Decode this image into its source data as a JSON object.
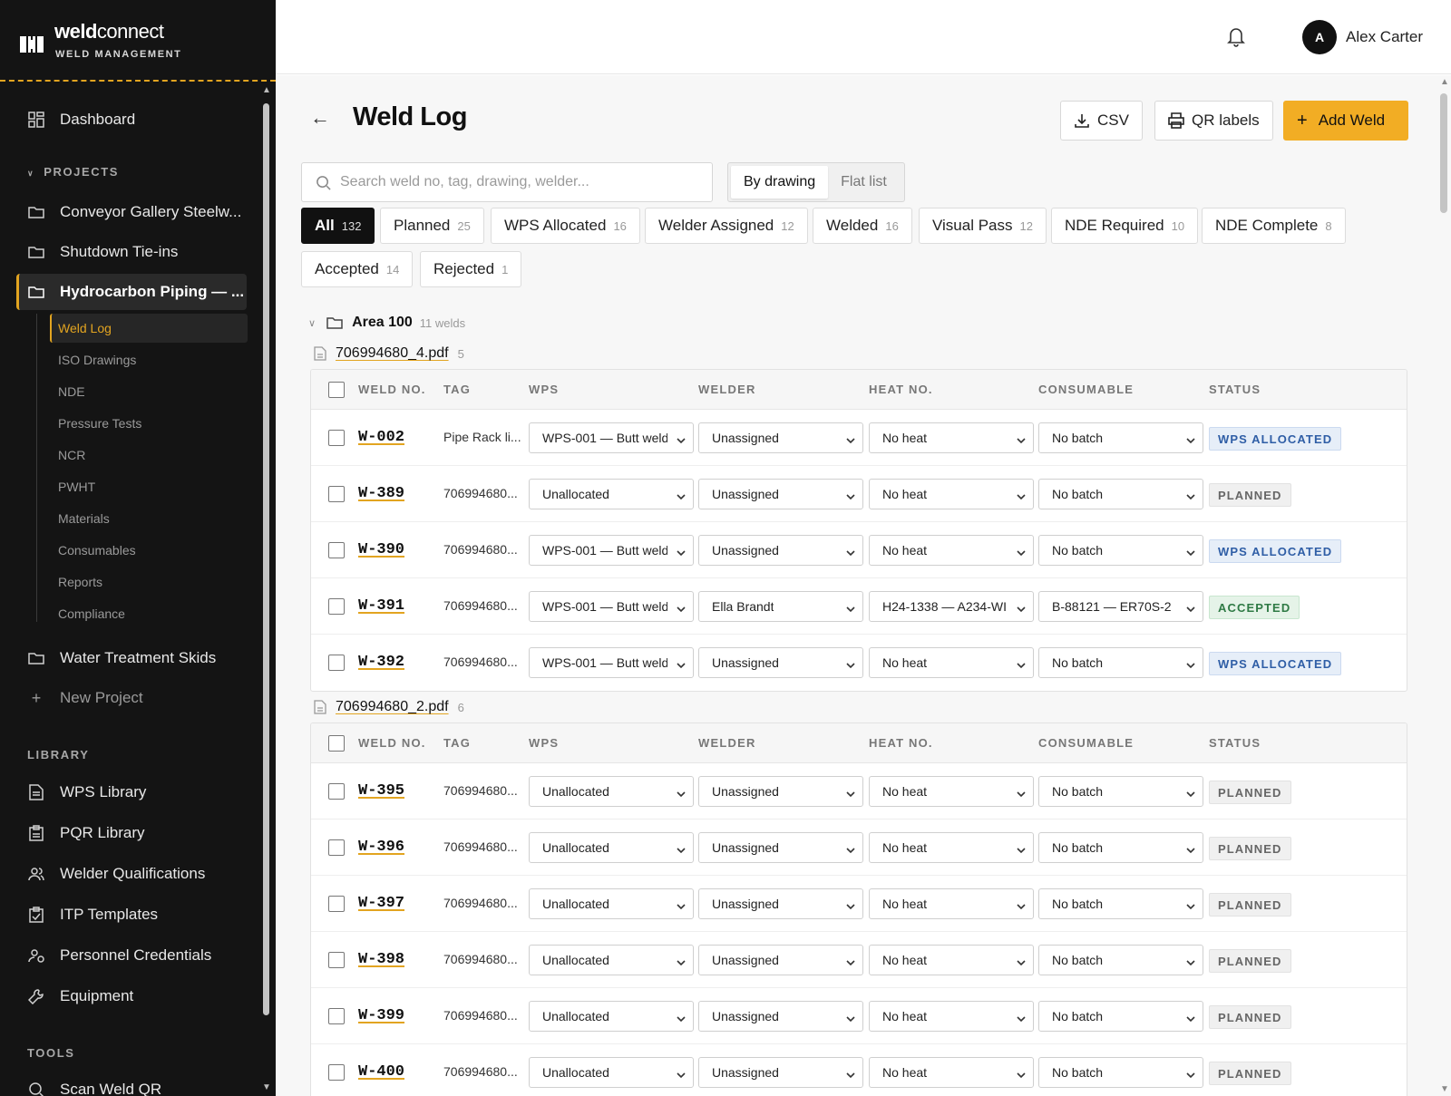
{
  "brand": {
    "name_bold": "weld",
    "name_rest": "connect",
    "subtitle": "WELD MANAGEMENT"
  },
  "sidebar": {
    "dashboard": "Dashboard",
    "projects_label": "PROJECTS",
    "projects": [
      {
        "label": "Conveyor Gallery Steelw...",
        "active": false
      },
      {
        "label": "Shutdown Tie-ins",
        "active": false
      },
      {
        "label": "Hydrocarbon Piping — ...",
        "active": true
      },
      {
        "label": "Water Treatment Skids",
        "active": false
      }
    ],
    "subnav": [
      "Weld Log",
      "ISO Drawings",
      "NDE",
      "Pressure Tests",
      "NCR",
      "PWHT",
      "Materials",
      "Consumables",
      "Reports",
      "Compliance"
    ],
    "new_project": "New Project",
    "library_label": "LIBRARY",
    "library": [
      {
        "label": "WPS Library",
        "icon": "document-icon"
      },
      {
        "label": "PQR Library",
        "icon": "clipboard-icon"
      },
      {
        "label": "Welder Qualifications",
        "icon": "users-icon"
      },
      {
        "label": "ITP Templates",
        "icon": "checklist-icon"
      },
      {
        "label": "Personnel Credentials",
        "icon": "user-badge-icon"
      },
      {
        "label": "Equipment",
        "icon": "wrench-icon"
      }
    ],
    "tools_label": "TOOLS",
    "tools": [
      {
        "label": "Scan Weld QR",
        "icon": "search-icon"
      }
    ]
  },
  "topbar": {
    "avatar_initial": "A",
    "user_name": "Alex Carter"
  },
  "page": {
    "title": "Weld Log",
    "buttons": {
      "csv": "CSV",
      "qr": "QR labels",
      "add": "Add Weld"
    },
    "search_placeholder": "Search weld no, tag, drawing, welder...",
    "view_toggle": {
      "by_drawing": "By drawing",
      "flat_list": "Flat list",
      "selected": "By drawing"
    },
    "filters": [
      {
        "label": "All",
        "count": "132",
        "active": true
      },
      {
        "label": "Planned",
        "count": "25"
      },
      {
        "label": "WPS Allocated",
        "count": "16"
      },
      {
        "label": "Welder Assigned",
        "count": "12"
      },
      {
        "label": "Welded",
        "count": "16"
      },
      {
        "label": "Visual Pass",
        "count": "12"
      },
      {
        "label": "NDE Required",
        "count": "10"
      },
      {
        "label": "NDE Complete",
        "count": "8"
      },
      {
        "label": "Accepted",
        "count": "14"
      },
      {
        "label": "Rejected",
        "count": "1"
      }
    ]
  },
  "columns": [
    "WELD NO.",
    "TAG",
    "WPS",
    "WELDER",
    "HEAT NO.",
    "CONSUMABLE",
    "STATUS"
  ],
  "group": {
    "name": "Area 100",
    "count": "11 welds"
  },
  "drawings": [
    {
      "file": "706994680_4.pdf",
      "count": "5",
      "rows": [
        {
          "weld": "W-002",
          "tag": "Pipe Rack li...",
          "wps": "WPS-001 — Butt weld",
          "welder": "Unassigned",
          "heat": "No heat",
          "consumable": "No batch",
          "status": "WPS ALLOCATED",
          "kind": "wps"
        },
        {
          "weld": "W-389",
          "tag": "706994680...",
          "wps": "Unallocated",
          "welder": "Unassigned",
          "heat": "No heat",
          "consumable": "No batch",
          "status": "PLANNED",
          "kind": "planned"
        },
        {
          "weld": "W-390",
          "tag": "706994680...",
          "wps": "WPS-001 — Butt weld",
          "welder": "Unassigned",
          "heat": "No heat",
          "consumable": "No batch",
          "status": "WPS ALLOCATED",
          "kind": "wps"
        },
        {
          "weld": "W-391",
          "tag": "706994680...",
          "wps": "WPS-001 — Butt weld",
          "welder": "Ella Brandt",
          "heat": "H24-1338 — A234-WI",
          "consumable": "B-88121 — ER70S-2",
          "status": "ACCEPTED",
          "kind": "accepted"
        },
        {
          "weld": "W-392",
          "tag": "706994680...",
          "wps": "WPS-001 — Butt weld",
          "welder": "Unassigned",
          "heat": "No heat",
          "consumable": "No batch",
          "status": "WPS ALLOCATED",
          "kind": "wps"
        }
      ]
    },
    {
      "file": "706994680_2.pdf",
      "count": "6",
      "rows": [
        {
          "weld": "W-395",
          "tag": "706994680...",
          "wps": "Unallocated",
          "welder": "Unassigned",
          "heat": "No heat",
          "consumable": "No batch",
          "status": "PLANNED",
          "kind": "planned"
        },
        {
          "weld": "W-396",
          "tag": "706994680...",
          "wps": "Unallocated",
          "welder": "Unassigned",
          "heat": "No heat",
          "consumable": "No batch",
          "status": "PLANNED",
          "kind": "planned"
        },
        {
          "weld": "W-397",
          "tag": "706994680...",
          "wps": "Unallocated",
          "welder": "Unassigned",
          "heat": "No heat",
          "consumable": "No batch",
          "status": "PLANNED",
          "kind": "planned"
        },
        {
          "weld": "W-398",
          "tag": "706994680...",
          "wps": "Unallocated",
          "welder": "Unassigned",
          "heat": "No heat",
          "consumable": "No batch",
          "status": "PLANNED",
          "kind": "planned"
        },
        {
          "weld": "W-399",
          "tag": "706994680...",
          "wps": "Unallocated",
          "welder": "Unassigned",
          "heat": "No heat",
          "consumable": "No batch",
          "status": "PLANNED",
          "kind": "planned"
        },
        {
          "weld": "W-400",
          "tag": "706994680...",
          "wps": "Unallocated",
          "welder": "Unassigned",
          "heat": "No heat",
          "consumable": "No batch",
          "status": "PLANNED",
          "kind": "planned"
        }
      ]
    }
  ],
  "colors": {
    "accent": "#f2ad24",
    "sidebar_bg": "#141414"
  }
}
